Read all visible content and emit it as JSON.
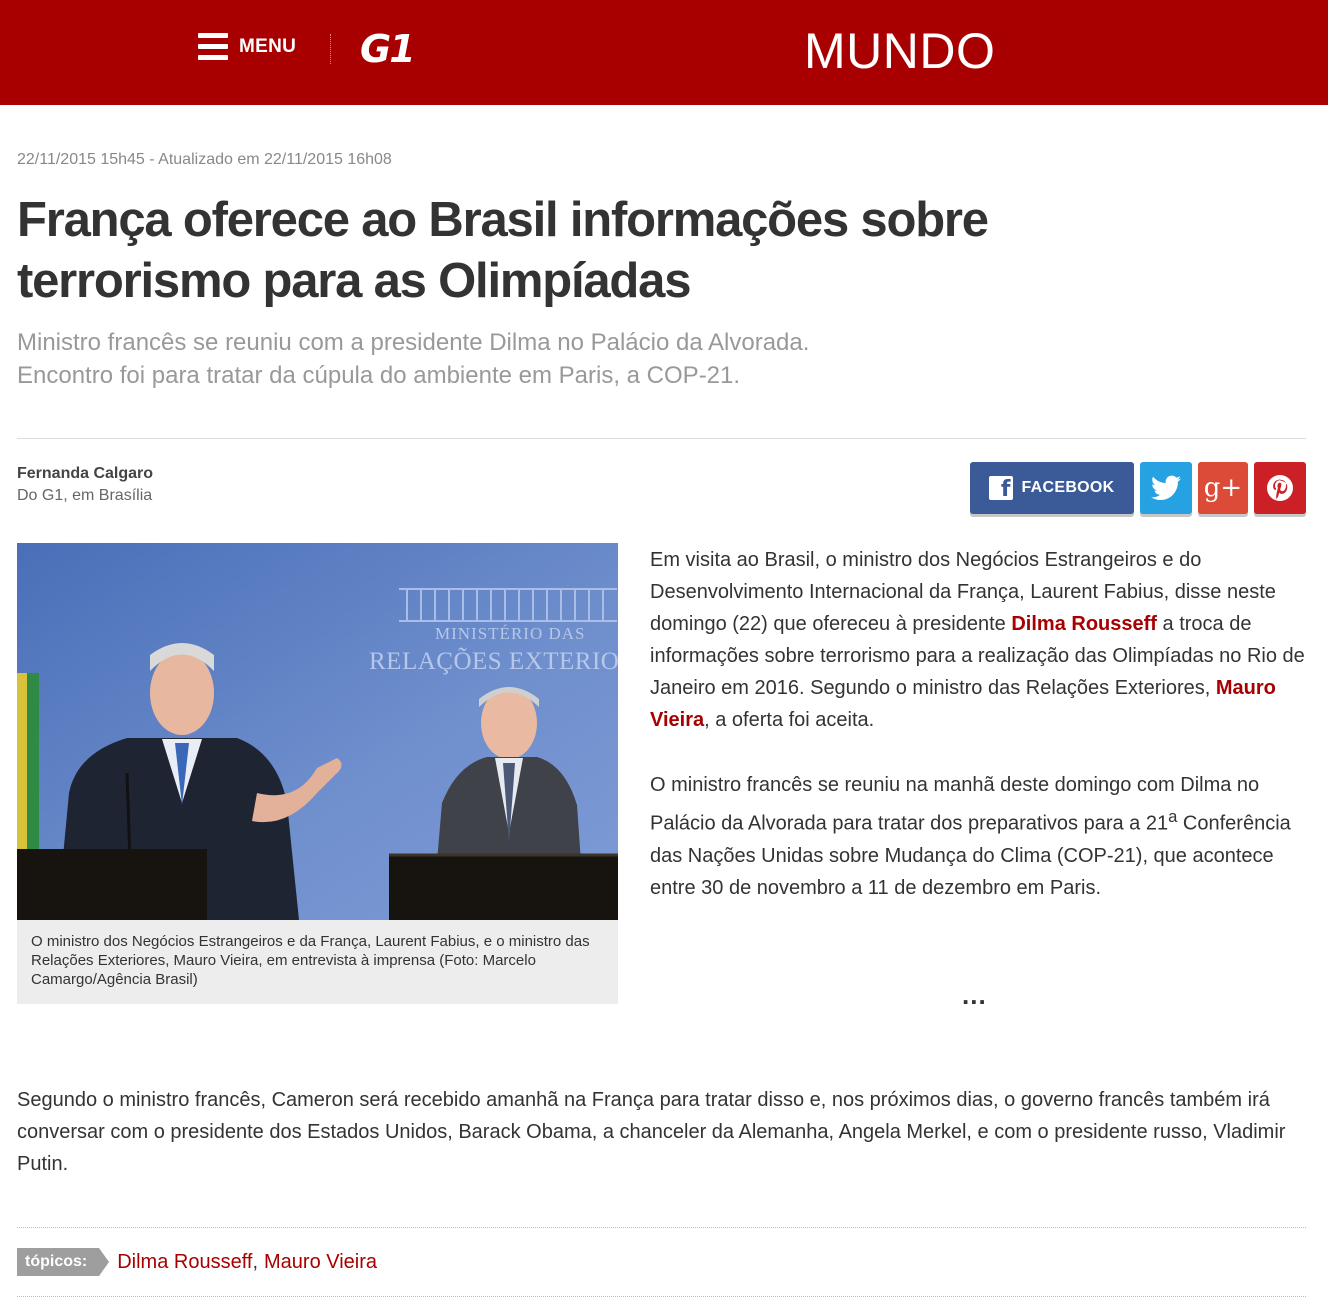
{
  "header": {
    "menu_label": "MENU",
    "logo_text": "G1",
    "section_title": "MUNDO",
    "background_color": "#a80000"
  },
  "article": {
    "date_line": "22/11/2015 15h45 - Atualizado em 22/11/2015 16h08",
    "headline": "França oferece ao Brasil informações sobre terrorismo para as Olimpíadas",
    "subtitle_line1": "Ministro francês se reuniu com a presidente Dilma no Palácio da Alvorada.",
    "subtitle_line2": "Encontro foi para tratar da cúpula do ambiente em Paris, a COP-21.",
    "author": "Fernanda Calgaro",
    "author_source": "Do G1, em Brasília",
    "photo": {
      "sign_line1": "MINISTÉRIO DAS",
      "sign_line2": "RELAÇÕES EXTERIORES",
      "caption": "O ministro dos Negócios Estrangeiros e da França, Laurent Fabius, e o ministro das Relações Exteriores, Mauro Vieira, em entrevista à imprensa (Foto: Marcelo Camargo/Agência Brasil)"
    },
    "paragraph1": {
      "before_link1": "Em visita ao Brasil, o ministro dos Negócios Estrangeiros e do Desenvolvimento Internacional da França, Laurent Fabius, disse neste domingo (22) que ofereceu à presidente ",
      "link1": "Dilma Rousseff",
      "between_links": " a troca de informações sobre terrorismo para a realização das Olimpíadas no Rio de Janeiro em 2016. Segundo o ministro das Relações Exteriores, ",
      "link2": "Mauro Vieira",
      "after_link2": ", a oferta foi aceita."
    },
    "paragraph2_before_sup": "O ministro francês se reuniu na manhã deste domingo com Dilma no Palácio da Alvorada para tratar dos preparativos para a 21",
    "paragraph2_sup": "a",
    "paragraph2_after_sup": " Conferência das Nações Unidas sobre Mudança do Clima (COP-21), que acontece entre 30 de novembro a 11 de dezembro em Paris.",
    "ellipsis": "...",
    "paragraph3": "Segundo o ministro francês, Cameron será recebido amanhã na França para tratar disso e, nos próximos dias, o governo francês também irá conversar com o presidente dos Estados Unidos, Barack Obama, a chanceler da Alemanha, Angela Merkel, e com o presidente russo, Vladimir Putin."
  },
  "share": {
    "facebook_label": "FACEBOOK",
    "facebook_color": "#3b5a98",
    "twitter_color": "#26a2e3",
    "gplus_glyph": "g+",
    "gplus_color": "#db4b38",
    "pinterest_color": "#cb2026"
  },
  "topics": {
    "label": "tópicos:",
    "items": [
      "Dilma Rousseff",
      "Mauro Vieira"
    ],
    "separator": ","
  }
}
